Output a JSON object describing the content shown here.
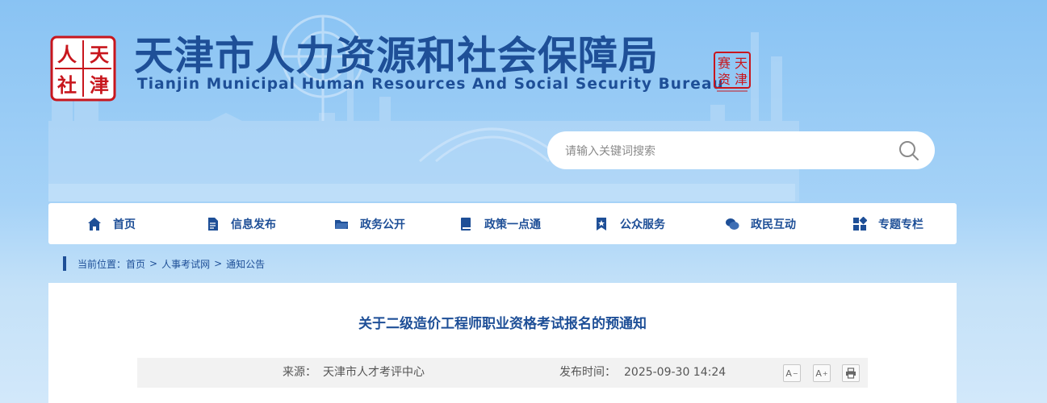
{
  "header": {
    "logo_text": [
      "人",
      "天",
      "社",
      "津"
    ],
    "title_cn": "天津市人力资源和社会保障局",
    "title_en": "Tianjin Municipal Human Resources And Social Security Bureau",
    "stamp_text": [
      "天",
      "津",
      "赛",
      "资"
    ]
  },
  "search": {
    "placeholder": "请输入关键词搜索"
  },
  "nav": {
    "items": [
      {
        "label": "首页",
        "icon": "home-icon"
      },
      {
        "label": "信息发布",
        "icon": "document-icon"
      },
      {
        "label": "政务公开",
        "icon": "folder-icon"
      },
      {
        "label": "政策一点通",
        "icon": "book-icon"
      },
      {
        "label": "公众服务",
        "icon": "bookmark-star-icon"
      },
      {
        "label": "政民互动",
        "icon": "chat-icon"
      },
      {
        "label": "专题专栏",
        "icon": "grid-icon"
      }
    ]
  },
  "breadcrumb": {
    "prefix": "当前位置：",
    "items": [
      "首页",
      "人事考试网",
      "通知公告"
    ],
    "separator": ">"
  },
  "article": {
    "title": "关于二级造价工程师职业资格考试报名的预通知",
    "source_label": "来源：",
    "source_value": "天津市人才考评中心",
    "date_label": "发布时间：",
    "date_value": "2025-09-30 14:24",
    "font_decrease": "A",
    "font_increase": "A",
    "font_decrease_sign": "−",
    "font_increase_sign": "+"
  },
  "colors": {
    "brand": "#1e4f97",
    "seal_red": "#c8161d",
    "background_top": "#89c3f3"
  }
}
